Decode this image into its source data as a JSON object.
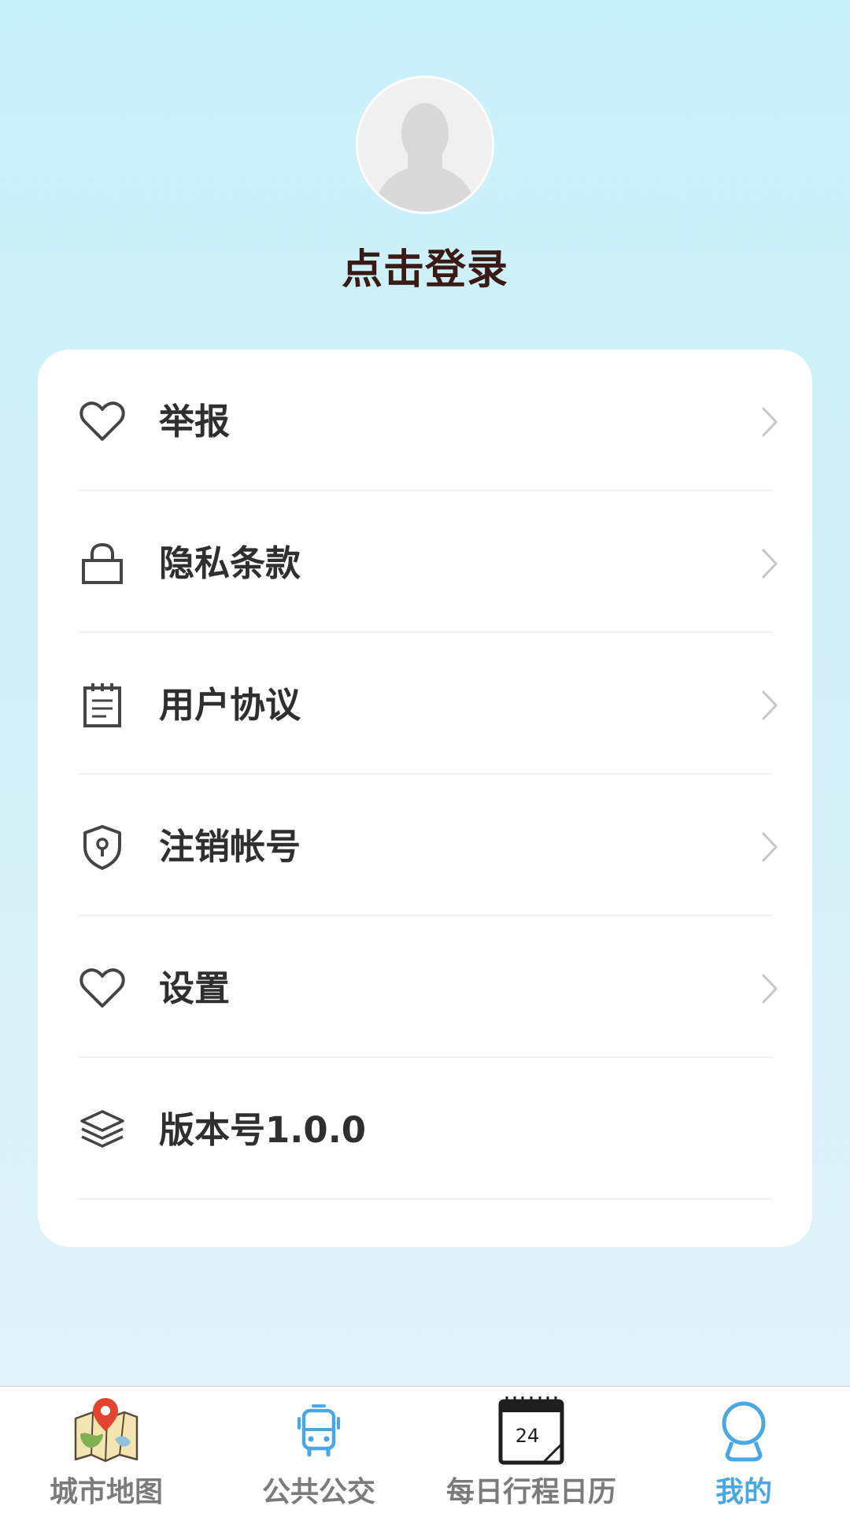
{
  "profile": {
    "login_label": "点击登录"
  },
  "menu": {
    "items": [
      {
        "label": "举报",
        "icon": "heart-icon",
        "chevron": true
      },
      {
        "label": "隐私条款",
        "icon": "lock-icon",
        "chevron": true
      },
      {
        "label": "用户协议",
        "icon": "notepad-icon",
        "chevron": true
      },
      {
        "label": "注销帐号",
        "icon": "shield-keyhole-icon",
        "chevron": true
      },
      {
        "label": "设置",
        "icon": "heart-icon",
        "chevron": true
      },
      {
        "label": "版本号1.0.0",
        "icon": "layers-icon",
        "chevron": false
      }
    ]
  },
  "tabbar": {
    "tabs": [
      {
        "label": "城市地图",
        "icon": "city-map-icon",
        "active": false
      },
      {
        "label": "公共公交",
        "icon": "bus-icon",
        "active": false
      },
      {
        "label": "每日行程日历",
        "icon": "calendar-icon",
        "active": false
      },
      {
        "label": "我的",
        "icon": "user-icon",
        "active": true
      }
    ],
    "calendar_day": "24"
  },
  "colors": {
    "active_tab": "#4aa7e6",
    "inactive_tab": "#7b7b7b",
    "title": "#3a1a14",
    "menu_text": "#2f2f2f"
  }
}
